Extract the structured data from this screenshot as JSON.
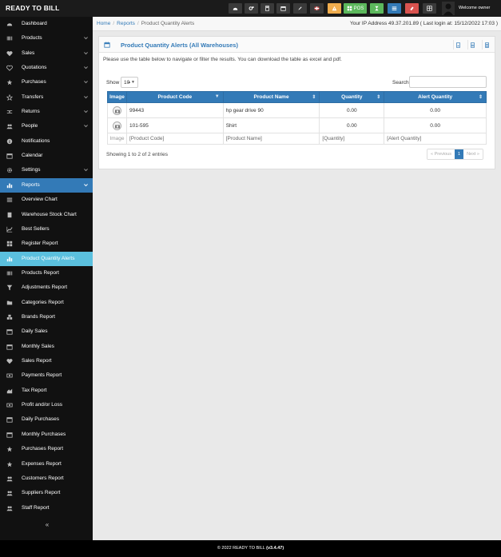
{
  "app": {
    "brand": "READY TO BILL",
    "welcome": "Welcome owner",
    "pos_label": "POS"
  },
  "sidebar": {
    "items": [
      {
        "label": "Dashboard",
        "icon": "dashboard-icon",
        "chevron": false
      },
      {
        "label": "Products",
        "icon": "barcode-icon",
        "chevron": true
      },
      {
        "label": "Sales",
        "icon": "heart-icon",
        "chevron": true
      },
      {
        "label": "Quotations",
        "icon": "heart-outline-icon",
        "chevron": true
      },
      {
        "label": "Purchases",
        "icon": "star-icon",
        "chevron": true
      },
      {
        "label": "Transfers",
        "icon": "star-outline-icon",
        "chevron": true
      },
      {
        "label": "Returns",
        "icon": "random-icon",
        "chevron": true
      },
      {
        "label": "People",
        "icon": "users-icon",
        "chevron": true
      },
      {
        "label": "Notifications",
        "icon": "info-icon",
        "chevron": false
      },
      {
        "label": "Calendar",
        "icon": "calendar-icon",
        "chevron": false
      },
      {
        "label": "Settings",
        "icon": "cog-icon",
        "chevron": true
      },
      {
        "label": "Reports",
        "icon": "bar-chart-icon",
        "chevron": true
      }
    ],
    "report_items": [
      {
        "label": "Overview Chart",
        "icon": "list-icon"
      },
      {
        "label": "Warehouse Stock Chart",
        "icon": "building-icon"
      },
      {
        "label": "Best Sellers",
        "icon": "line-chart-icon"
      },
      {
        "label": "Register Report",
        "icon": "th-large-icon"
      },
      {
        "label": "Product Quantity Alerts",
        "icon": "bar-chart-icon"
      },
      {
        "label": "Products Report",
        "icon": "barcode-icon"
      },
      {
        "label": "Adjustments Report",
        "icon": "filter-icon"
      },
      {
        "label": "Categories Report",
        "icon": "folder-open-icon"
      },
      {
        "label": "Brands Report",
        "icon": "cubes-icon"
      },
      {
        "label": "Daily Sales",
        "icon": "calendar-icon"
      },
      {
        "label": "Monthly Sales",
        "icon": "calendar-icon"
      },
      {
        "label": "Sales Report",
        "icon": "heart-icon"
      },
      {
        "label": "Payments Report",
        "icon": "money-icon"
      },
      {
        "label": "Tax Report",
        "icon": "area-chart-icon"
      },
      {
        "label": "Profit and/or Loss",
        "icon": "money-icon"
      },
      {
        "label": "Daily Purchases",
        "icon": "calendar-icon"
      },
      {
        "label": "Monthly Purchases",
        "icon": "calendar-icon"
      },
      {
        "label": "Purchases Report",
        "icon": "star-icon"
      },
      {
        "label": "Expenses Report",
        "icon": "star-icon"
      },
      {
        "label": "Customers Report",
        "icon": "users-icon"
      },
      {
        "label": "Suppliers Report",
        "icon": "users-icon"
      },
      {
        "label": "Staff Report",
        "icon": "users-icon"
      }
    ],
    "collapse_glyph": "«"
  },
  "breadcrumb": {
    "home": "Home",
    "reports": "Reports",
    "current": "Product Quantity Alerts"
  },
  "ip_info": "Your IP Address 49.37.201.89 ( Last login at: 15/12/2022 17:03 )",
  "panel": {
    "title": "Product Quantity Alerts (All Warehouses)",
    "intro": "Please use the table below to navigate or filter the results. You can download the table as excel and pdf.",
    "show_label": "Show",
    "show_value": "10",
    "search_label": "Search"
  },
  "table": {
    "headers": [
      "Image",
      "Product Code",
      "Product Name",
      "Quantity",
      "Alert Quantity"
    ],
    "rows": [
      {
        "code": "99443",
        "name": "hp gear drive 90",
        "quantity": "0.00",
        "alert": "0.00"
      },
      {
        "code": "101-595",
        "name": "Shirt",
        "quantity": "0.00",
        "alert": "0.00"
      }
    ],
    "footer": [
      "Image",
      "[Product Code]",
      "[Product Name]",
      "[Quantity]",
      "[Alert Quantity]"
    ]
  },
  "info_text": "Showing 1 to 2 of 2 entries",
  "pager": {
    "prev": "« Previous",
    "page": "1",
    "next": "Next »"
  },
  "footer": {
    "text": "© 2022 READY TO BILL",
    "version": "(v3.4.47)"
  },
  "colors": {
    "accent": "#337ab7",
    "active_sub": "#5bc0de",
    "sidebar_bg": "#111111"
  }
}
